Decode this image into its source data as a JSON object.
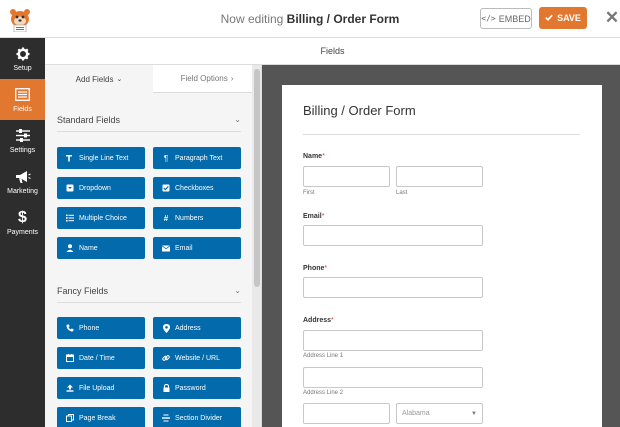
{
  "header": {
    "title_prefix": "Now editing",
    "title_form": "Billing / Order Form",
    "embed_label": "EMBED",
    "save_label": "SAVE"
  },
  "leftnav": [
    {
      "label": "Setup",
      "icon": "gear-icon",
      "active": false
    },
    {
      "label": "Fields",
      "icon": "list-icon",
      "active": true
    },
    {
      "label": "Settings",
      "icon": "sliders-icon",
      "active": false
    },
    {
      "label": "Marketing",
      "icon": "megaphone-icon",
      "active": false
    },
    {
      "label": "Payments",
      "icon": "dollar-icon",
      "active": false
    }
  ],
  "fields_header": "Fields",
  "panel": {
    "tab_add": "Add Fields",
    "tab_options": "Field Options",
    "standard_title": "Standard Fields",
    "standard": [
      {
        "label": "Single Line Text",
        "icon": "text-icon"
      },
      {
        "label": "Paragraph Text",
        "icon": "paragraph-icon"
      },
      {
        "label": "Dropdown",
        "icon": "dropdown-icon"
      },
      {
        "label": "Checkboxes",
        "icon": "checkbox-icon"
      },
      {
        "label": "Multiple Choice",
        "icon": "list-icon"
      },
      {
        "label": "Numbers",
        "icon": "hash-icon"
      },
      {
        "label": "Name",
        "icon": "user-icon"
      },
      {
        "label": "Email",
        "icon": "envelope-icon"
      }
    ],
    "fancy_title": "Fancy Fields",
    "fancy": [
      {
        "label": "Phone",
        "icon": "phone-icon"
      },
      {
        "label": "Address",
        "icon": "map-pin-icon"
      },
      {
        "label": "Date / Time",
        "icon": "calendar-icon"
      },
      {
        "label": "Website / URL",
        "icon": "link-icon"
      },
      {
        "label": "File Upload",
        "icon": "upload-icon"
      },
      {
        "label": "Password",
        "icon": "lock-icon"
      },
      {
        "label": "Page Break",
        "icon": "copy-icon"
      },
      {
        "label": "Section Divider",
        "icon": "divider-icon"
      }
    ]
  },
  "form": {
    "title": "Billing / Order Form",
    "name_label": "Name",
    "first_sub": "First",
    "last_sub": "Last",
    "email_label": "Email",
    "phone_label": "Phone",
    "address_label": "Address",
    "address1_sub": "Address Line 1",
    "address2_sub": "Address Line 2",
    "state_value": "Alabama",
    "required_mark": "*"
  },
  "colors": {
    "accent": "#e27730",
    "field_button": "#036aab",
    "nav_bg": "#2d2d2d"
  }
}
